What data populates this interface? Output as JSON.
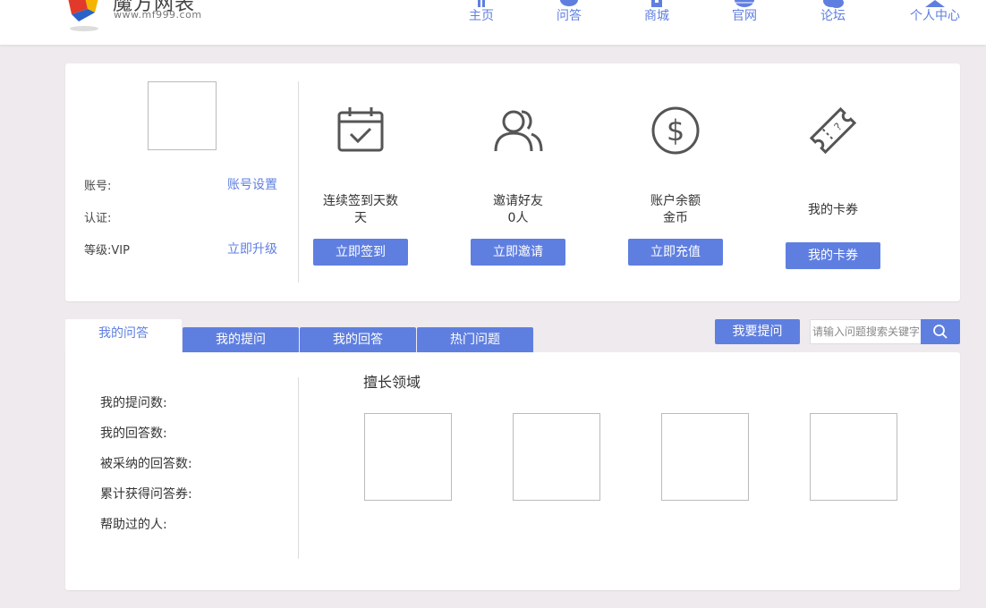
{
  "header": {
    "logo_name": "魔方网表",
    "logo_url": "www.mf999.com",
    "colors": {
      "accent": "#5f7fe0",
      "background": "#eeeaee"
    },
    "nav": [
      {
        "label": "主页",
        "icon": "home-icon"
      },
      {
        "label": "问答",
        "icon": "chat-icon"
      },
      {
        "label": "商城",
        "icon": "shop-icon"
      },
      {
        "label": "官网",
        "icon": "globe-icon"
      },
      {
        "label": "论坛",
        "icon": "forum-icon"
      },
      {
        "label": "个人中心",
        "icon": "user-icon"
      }
    ]
  },
  "profile": {
    "account_label": "账号:",
    "account_settings": "账号设置",
    "cert_label": "认证:",
    "level_label": "等级:VIP",
    "upgrade": "立即升级"
  },
  "stats": [
    {
      "icon": "calendar-check-icon",
      "line1": "连续签到天数",
      "line2": "天",
      "button": "立即签到"
    },
    {
      "icon": "users-icon",
      "line1": "邀请好友",
      "line2": "0人",
      "button": "立即邀请"
    },
    {
      "icon": "dollar-icon",
      "line1": "账户余额",
      "line2": "金币",
      "button": "立即充值"
    },
    {
      "icon": "ticket-icon",
      "line1": "我的卡券",
      "line2": "",
      "button": "我的卡券"
    }
  ],
  "tabs": [
    "我的问答",
    "我的提问",
    "我的回答",
    "热门问题"
  ],
  "ask_button": "我要提问",
  "search": {
    "placeholder": "请输入问题搜索关键字",
    "icon": "search-icon"
  },
  "qa_stats": [
    "我的提问数:",
    "我的回答数:",
    "被采纳的回答数:",
    "累计获得问答券:",
    "帮助过的人:"
  ],
  "expert_title": "擅长领域"
}
